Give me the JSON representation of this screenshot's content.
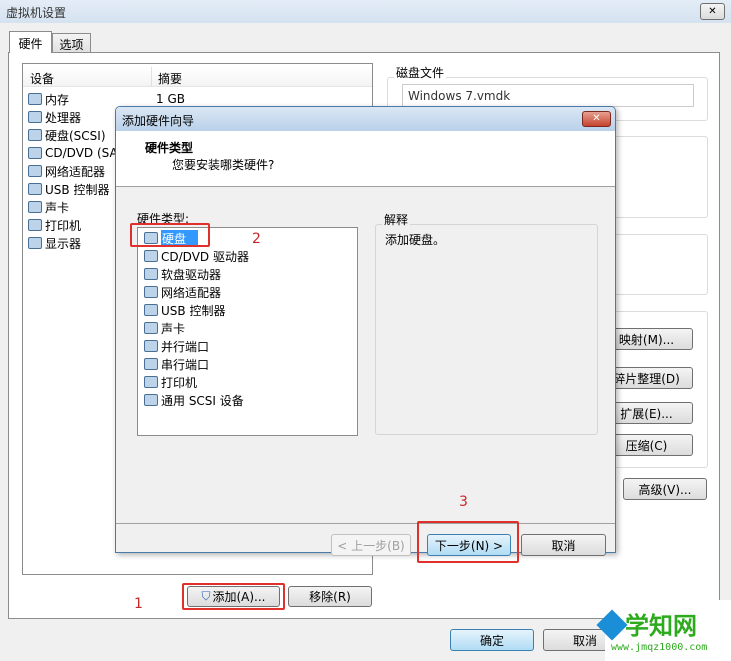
{
  "window": {
    "title": "虚拟机设置",
    "close_label": "✕"
  },
  "tabs": [
    {
      "label": "硬件"
    },
    {
      "label": "选项"
    }
  ],
  "device_list": {
    "columns": [
      "设备",
      "摘要"
    ],
    "rows": [
      {
        "device": "内存",
        "summary": "1 GB",
        "icon": "memory-icon"
      },
      {
        "device": "处理器",
        "summary": "",
        "icon": "cpu-icon"
      },
      {
        "device": "硬盘(SCSI)",
        "summary": "",
        "icon": "hard-disk-icon"
      },
      {
        "device": "CD/DVD (SA",
        "summary": "",
        "icon": "cd-icon"
      },
      {
        "device": "网络适配器",
        "summary": "",
        "icon": "network-icon"
      },
      {
        "device": "USB 控制器",
        "summary": "",
        "icon": "usb-icon"
      },
      {
        "device": "声卡",
        "summary": "",
        "icon": "sound-icon"
      },
      {
        "device": "打印机",
        "summary": "",
        "icon": "printer-icon"
      },
      {
        "device": "显示器",
        "summary": "",
        "icon": "display-icon"
      }
    ]
  },
  "buttons": {
    "add": "添加(A)...",
    "remove": "移除(R)",
    "ok": "确定",
    "cancel": "取消"
  },
  "disk": {
    "file_label": "磁盘文件",
    "file_value": "Windows 7.vmdk",
    "map": "映射(M)...",
    "defrag": "碎片整理(D)",
    "expand": "扩展(E)...",
    "compact": "压缩(C)",
    "advanced": "高级(V)..."
  },
  "wizard": {
    "title": "添加硬件向导",
    "close_label": "✕",
    "heading": "硬件类型",
    "subheading": "您要安装哪类硬件?",
    "list_label": "硬件类型:",
    "items": [
      {
        "label": "硬盘",
        "icon": "hard-disk-icon"
      },
      {
        "label": "CD/DVD 驱动器",
        "icon": "cd-icon"
      },
      {
        "label": "软盘驱动器",
        "icon": "floppy-icon"
      },
      {
        "label": "网络适配器",
        "icon": "network-icon"
      },
      {
        "label": "USB 控制器",
        "icon": "usb-icon"
      },
      {
        "label": "声卡",
        "icon": "sound-icon"
      },
      {
        "label": "并行端口",
        "icon": "parallel-port-icon"
      },
      {
        "label": "串行端口",
        "icon": "serial-port-icon"
      },
      {
        "label": "打印机",
        "icon": "printer-icon"
      },
      {
        "label": "通用 SCSI 设备",
        "icon": "scsi-icon"
      }
    ],
    "selected_index": 0,
    "explain_label": "解释",
    "explain_text": "添加硬盘。",
    "back": "< 上一步(B)",
    "next": "下一步(N) >",
    "cancel": "取消"
  },
  "annotations": [
    "1",
    "2",
    "3"
  ],
  "watermark": {
    "logo": "学知网",
    "url": "www.jmqz1000.com"
  }
}
